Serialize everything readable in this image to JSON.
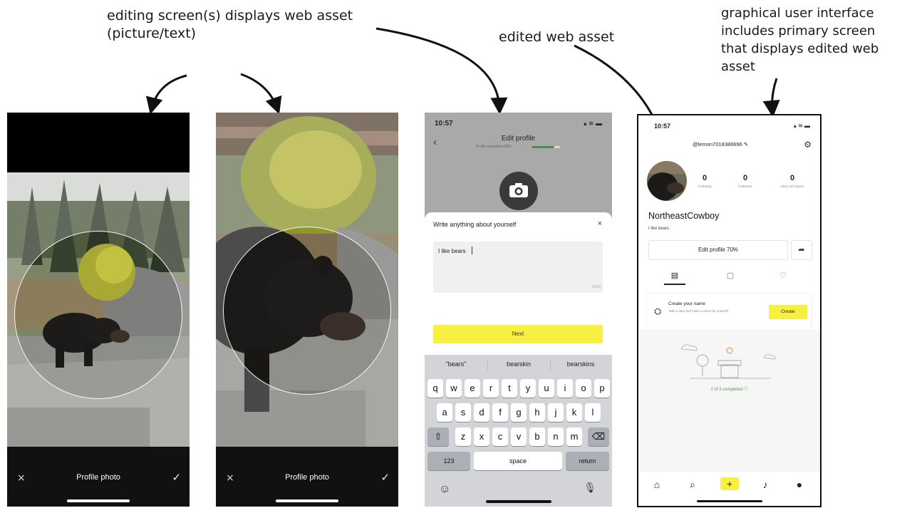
{
  "annotations": {
    "editing_screens": [
      "editing screen(s) displays web asset",
      "(picture/text)"
    ],
    "edited_asset": "edited web asset",
    "gui": [
      "graphical user interface",
      "includes primary screen",
      "that displays edited web",
      "asset"
    ]
  },
  "crop_screen_left": {
    "title": "Profile photo",
    "cancel": "×",
    "confirm": "✓"
  },
  "crop_screen_right": {
    "title": "Profile photo",
    "cancel": "×",
    "confirm": "✓"
  },
  "bio_screen": {
    "time": "10:57",
    "status": "▴ ≋ ▬",
    "back": "‹",
    "title": "Edit profile",
    "progress_text": "Profile completed 80%",
    "progress_value": 0.8,
    "sheet_title": "Write anything about yourself",
    "close": "×",
    "text_value": "I like bears",
    "counter": "12/80",
    "next_label": "Next",
    "suggestions": [
      "\"bears\"",
      "bearskin",
      "bearskins"
    ],
    "keyboard": {
      "row1": [
        "q",
        "w",
        "e",
        "r",
        "t",
        "y",
        "u",
        "i",
        "o",
        "p"
      ],
      "row2": [
        "a",
        "s",
        "d",
        "f",
        "g",
        "h",
        "j",
        "k",
        "l"
      ],
      "row3": [
        "z",
        "x",
        "c",
        "v",
        "b",
        "n",
        "m"
      ],
      "shift": "⇧",
      "delete": "⌫",
      "numbers": "123",
      "space": "space",
      "return": "return",
      "emoji": "☺",
      "mic": "🎙"
    }
  },
  "profile_screen": {
    "time": "10:57",
    "status": "▴ ≋ ▬",
    "handle": "@lemon7018386696 ✎",
    "settings": "⚙",
    "stats": [
      {
        "value": "0",
        "label": "Following"
      },
      {
        "value": "0",
        "label": "Followers"
      },
      {
        "value": "0",
        "label": "Likes and Saves"
      }
    ],
    "name": "NortheastCowboy",
    "bio": "I like bears",
    "edit_button": "Edit profile 70%",
    "share": "➦",
    "tabs": [
      "▤",
      "▢",
      "♡"
    ],
    "card": {
      "title": "Create your name",
      "subtitle": "Take a step and make a name for yourself.",
      "button": "Create"
    },
    "completed": "2 of 3 completed ⓘ",
    "nav": [
      "⌂",
      "⌕",
      "+",
      "♪",
      "●"
    ]
  }
}
